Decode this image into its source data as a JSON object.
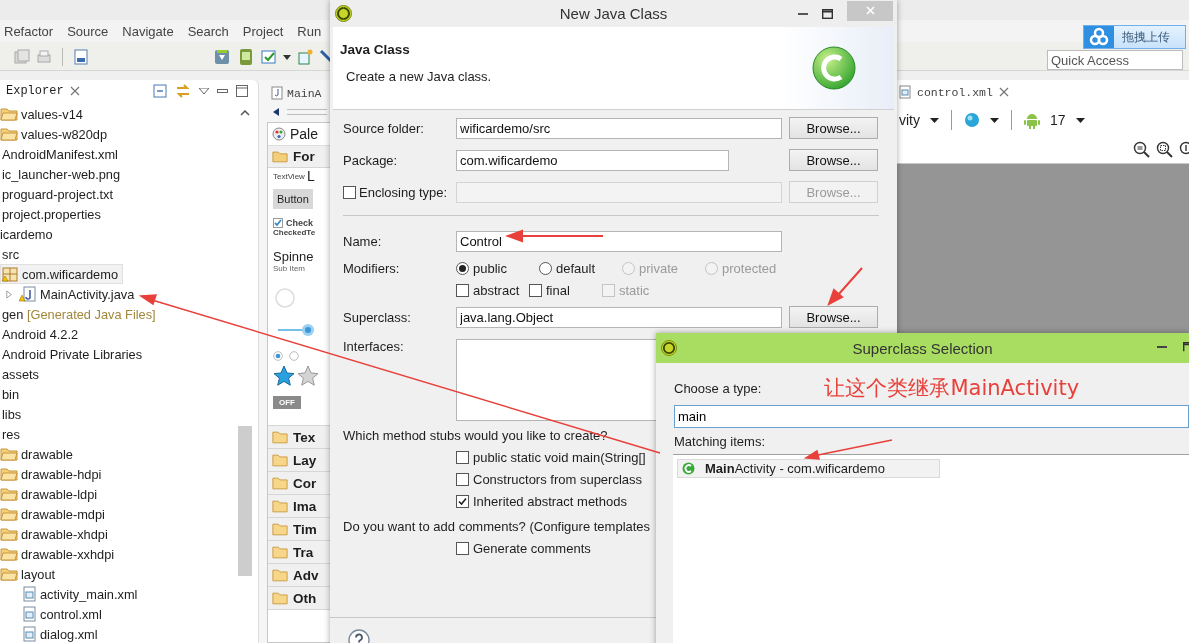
{
  "ide": {
    "menu": [
      "Refactor",
      "Source",
      "Navigate",
      "Search",
      "Project",
      "Run"
    ],
    "upload_button": "拖拽上传",
    "quick_access": {
      "placeholder": "Quick Access"
    },
    "explorer": {
      "title": "Explorer",
      "tree": [
        {
          "children": [
            {
              "children": [
                {
                  "label": "values-v14",
                  "kind": "folder",
                  "selected": false
                },
                {
                  "label": "values-w820dp",
                  "kind": "folder",
                  "selected": false
                }
              ]
            },
            {
              "label": "AndroidManifest.xml",
              "selected": false
            },
            {
              "label": "ic_launcher-web.png",
              "selected": false
            },
            {
              "label": "proguard-project.txt",
              "selected": false
            },
            {
              "label": "project.properties",
              "selected": false
            }
          ]
        },
        {
          "label": "icardemo",
          "selected": false,
          "children": [
            {
              "label": "src",
              "selected": false,
              "children": [
                {
                  "label": "com.wificardemo",
                  "kind": "package",
                  "selected": true,
                  "children": [
                    {
                      "label": "MainActivity.java",
                      "kind": "java",
                      "selected": false,
                      "expanded": false
                    }
                  ]
                }
              ]
            },
            {
              "label": "gen",
              "decoration": "[Generated Java Files]",
              "selected": false
            },
            {
              "label": "Android 4.2.2",
              "selected": false
            },
            {
              "label": "Android Private Libraries",
              "selected": false
            },
            {
              "label": "assets",
              "selected": false
            },
            {
              "label": "bin",
              "selected": false
            },
            {
              "label": "libs",
              "selected": false
            },
            {
              "label": "res",
              "selected": false,
              "children": [
                {
                  "label": "drawable",
                  "kind": "folder",
                  "selected": false
                },
                {
                  "label": "drawable-hdpi",
                  "kind": "folder",
                  "selected": false
                },
                {
                  "label": "drawable-ldpi",
                  "kind": "folder",
                  "selected": false
                },
                {
                  "label": "drawable-mdpi",
                  "kind": "folder",
                  "selected": false
                },
                {
                  "label": "drawable-xhdpi",
                  "kind": "folder",
                  "selected": false
                },
                {
                  "label": "drawable-xxhdpi",
                  "kind": "folder",
                  "selected": false
                },
                {
                  "label": "layout",
                  "kind": "folder",
                  "selected": false,
                  "children": [
                    {
                      "label": "activity_main.xml",
                      "kind": "xml",
                      "selected": false
                    },
                    {
                      "label": "control.xml",
                      "kind": "xml",
                      "selected": false
                    },
                    {
                      "label": "dialog.xml",
                      "kind": "xml",
                      "selected": false
                    }
                  ]
                }
              ]
            }
          ]
        }
      ]
    },
    "palette_editor": {
      "tab": "MainA",
      "palette_title": "Pale",
      "drawer": "For",
      "textview_label": "TextView",
      "large_text": "L",
      "button": "Button",
      "checkbox": {
        "label": "Check",
        "checked": true
      },
      "checked_text": "CheckedTe",
      "spinner": {
        "text": "Spinne",
        "subtext": "Sub Item"
      },
      "radios": [
        {
          "selected": true
        },
        {
          "selected": false
        }
      ],
      "toggle": "OFF",
      "categories": [
        "Tex",
        "Lay",
        "Cor",
        "Ima",
        "Tim",
        "Tra",
        "Adv",
        "Oth"
      ]
    },
    "layout_editor": {
      "tab": "control.xml",
      "theme": "vity",
      "api_level": "17"
    }
  },
  "new_class_dialog": {
    "title": "New Java Class",
    "heading": "Java Class",
    "description": "Create a new Java class.",
    "source_folder": {
      "label": "Source folder:",
      "value": "wificardemo/src",
      "button": "Browse..."
    },
    "package": {
      "label": "Package:",
      "value": "com.wificardemo",
      "button": "Browse..."
    },
    "enclosing_type": {
      "label": "Enclosing type:",
      "checked": false,
      "disabled": true,
      "button": "Browse..."
    },
    "name": {
      "label": "Name:",
      "value": "Control"
    },
    "modifiers": {
      "label": "Modifiers:",
      "access": [
        {
          "label": "public",
          "selected": true,
          "disabled": false
        },
        {
          "label": "default",
          "selected": false,
          "disabled": false
        },
        {
          "label": "private",
          "selected": false,
          "disabled": true
        },
        {
          "label": "protected",
          "selected": false,
          "disabled": true
        }
      ],
      "flags": [
        {
          "label": "abstract",
          "checked": false,
          "disabled": false
        },
        {
          "label": "final",
          "checked": false,
          "disabled": false
        },
        {
          "label": "static",
          "checked": false,
          "disabled": true
        }
      ]
    },
    "superclass": {
      "label": "Superclass:",
      "value": "java.lang.Object",
      "button": "Browse..."
    },
    "interfaces": {
      "label": "Interfaces:"
    },
    "stubs_question": "Which method stubs would you like to create?",
    "stubs": [
      {
        "label": "public static void main(String[]",
        "checked": false
      },
      {
        "label": "Constructors from superclass",
        "checked": false
      },
      {
        "label": "Inherited abstract methods",
        "checked": true
      }
    ],
    "comments_question": "Do you want to add comments? (Configure templates",
    "comments": [
      {
        "label": "Generate comments",
        "checked": false
      }
    ]
  },
  "superclass_dialog": {
    "title": "Superclass Selection",
    "prompt": "Choose a type:",
    "filter": "main",
    "list_label": "Matching items:",
    "items": [
      {
        "name": "**Main**Activity - com.wificardemo",
        "selected": true
      }
    ]
  },
  "annotation": {
    "text": "让这个类继承MainActivity"
  }
}
